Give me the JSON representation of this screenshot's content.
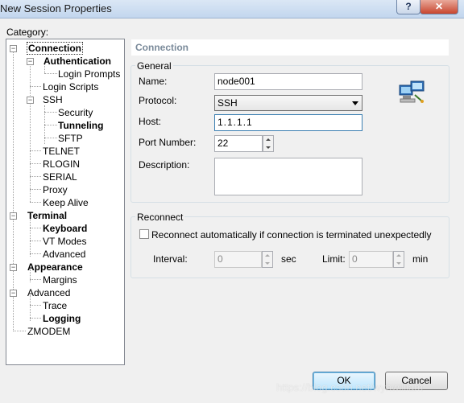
{
  "window": {
    "title": "New Session Properties",
    "help_glyph": "?",
    "close_glyph": "✕"
  },
  "category_label": "Category:",
  "tree": {
    "connection": "Connection",
    "authentication": "Authentication",
    "login_prompts": "Login Prompts",
    "login_scripts": "Login Scripts",
    "ssh": "SSH",
    "security": "Security",
    "tunneling": "Tunneling",
    "sftp": "SFTP",
    "telnet": "TELNET",
    "rlogin": "RLOGIN",
    "serial": "SERIAL",
    "proxy": "Proxy",
    "keep_alive": "Keep Alive",
    "terminal": "Terminal",
    "keyboard": "Keyboard",
    "vt_modes": "VT Modes",
    "advanced_terminal": "Advanced",
    "appearance": "Appearance",
    "margins": "Margins",
    "advanced": "Advanced",
    "trace": "Trace",
    "logging": "Logging",
    "zmodem": "ZMODEM",
    "expanded_glyph": "−"
  },
  "panel": {
    "header": "Connection",
    "general": {
      "legend": "General",
      "name_label": "Name:",
      "name_value": "node001",
      "protocol_label": "Protocol:",
      "protocol_value": "SSH",
      "host_label": "Host:",
      "host_value": "1.1.1.1",
      "port_label": "Port Number:",
      "port_value": "22",
      "description_label": "Description:",
      "description_value": ""
    },
    "reconnect": {
      "legend": "Reconnect",
      "checkbox_label": "Reconnect automatically if connection is terminated unexpectedly",
      "interval_label": "Interval:",
      "interval_value": "0",
      "interval_unit": "sec",
      "limit_label": "Limit:",
      "limit_value": "0",
      "limit_unit": "min"
    }
  },
  "buttons": {
    "ok": "OK",
    "cancel": "Cancel"
  },
  "watermark": "https://blog.csdn.net/wyhwilliam"
}
